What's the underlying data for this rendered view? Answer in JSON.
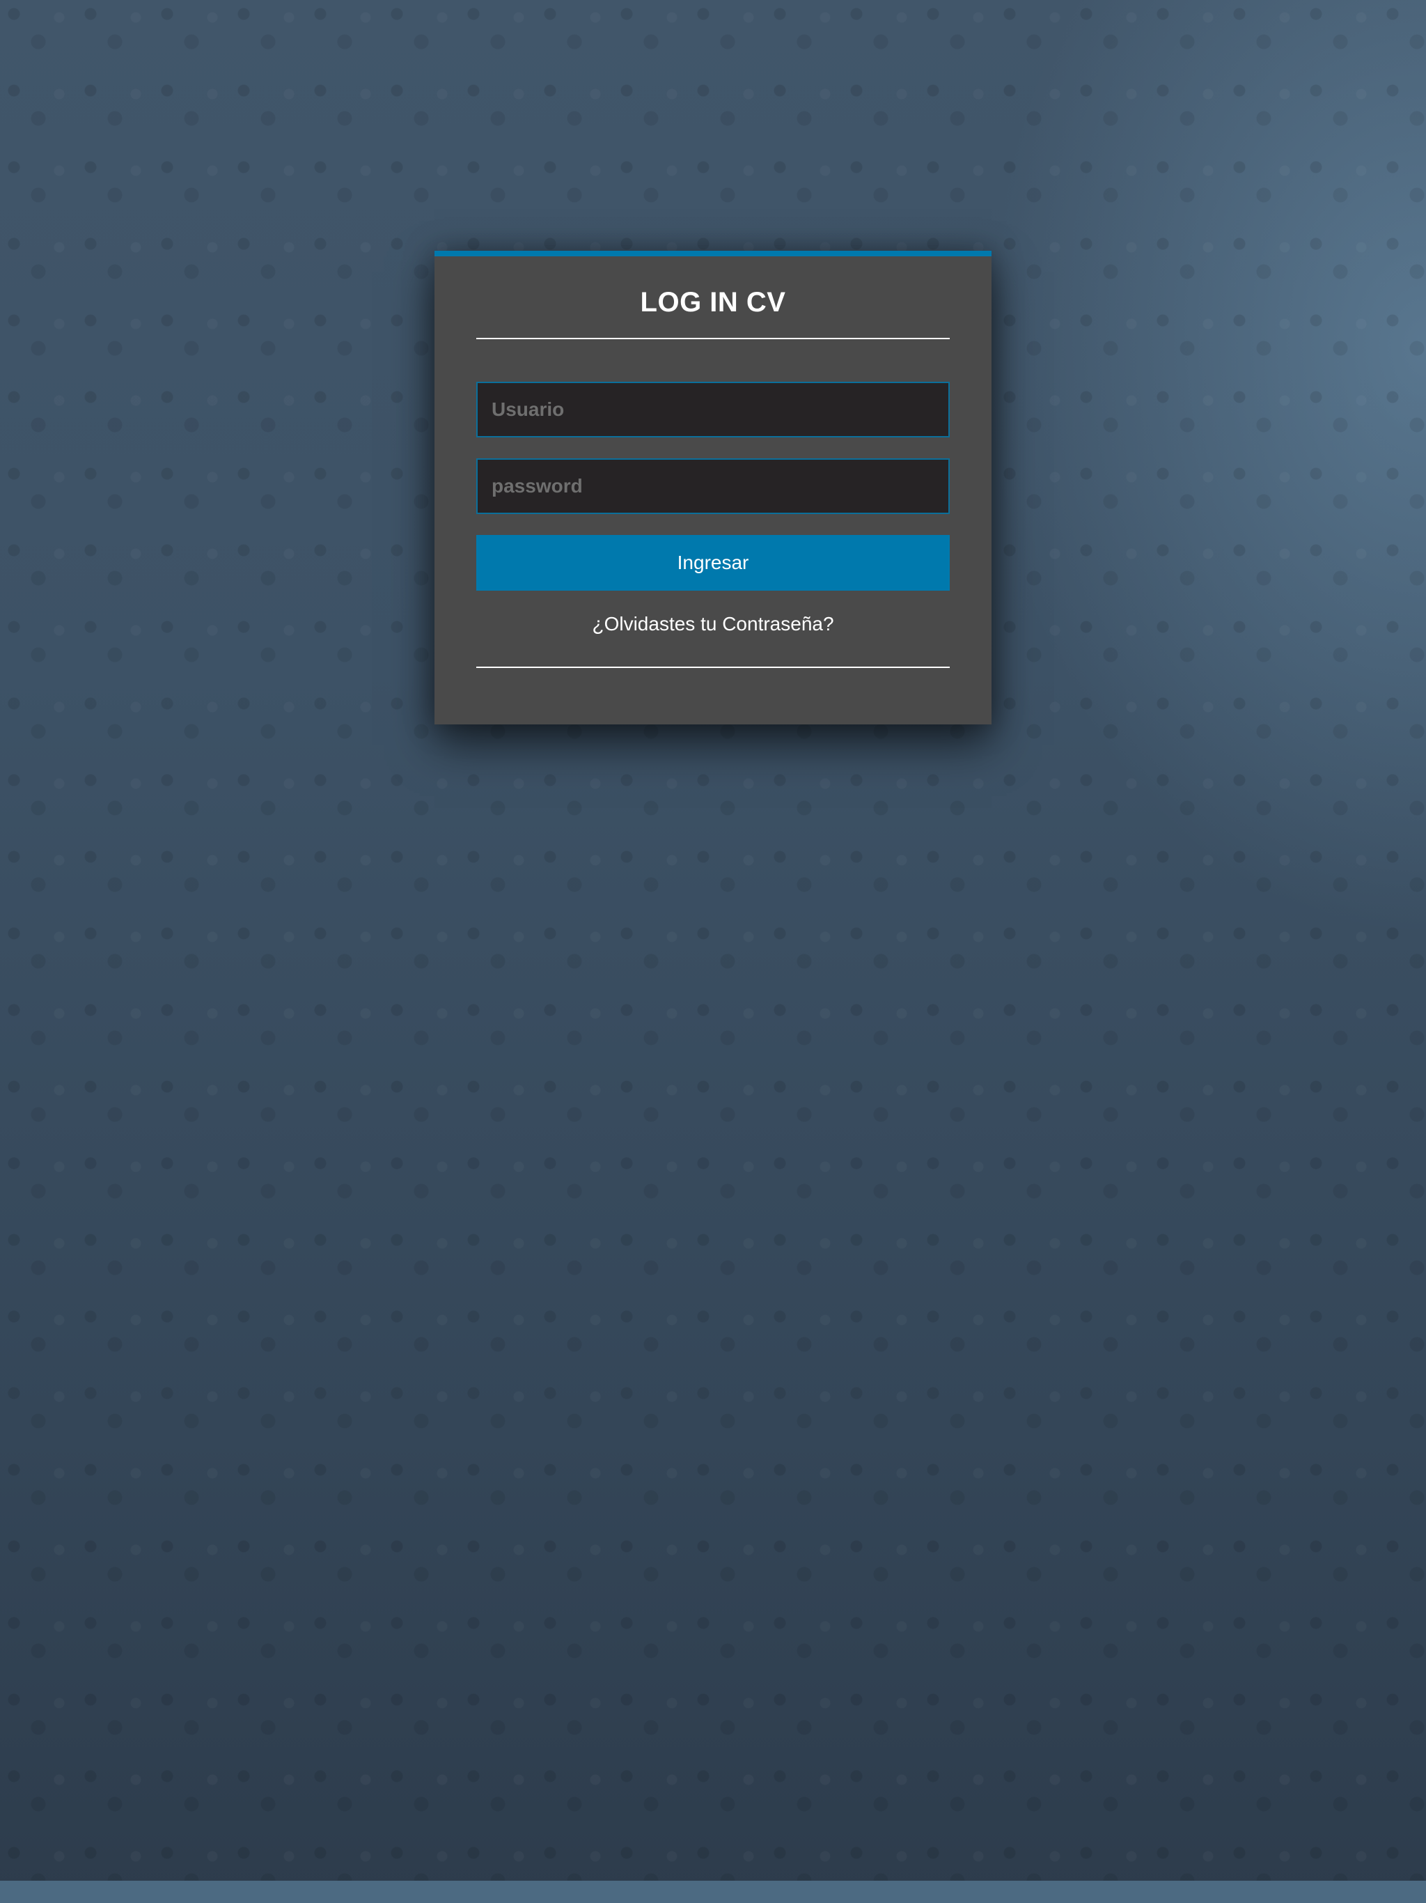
{
  "login": {
    "title": "LOG IN CV",
    "username_placeholder": "Usuario",
    "password_placeholder": "password",
    "submit_label": "Ingresar",
    "forgot_link": "¿Olvidastes tu Contraseña?"
  },
  "colors": {
    "accent": "#0079ad",
    "card_background": "#4a4a4a",
    "input_background": "#262325"
  }
}
